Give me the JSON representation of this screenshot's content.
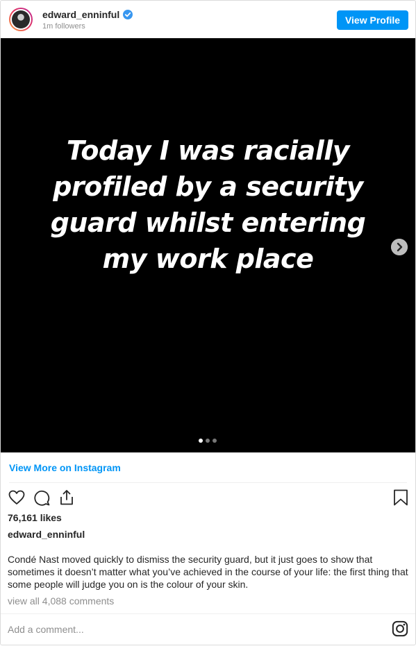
{
  "header": {
    "username": "edward_enninful",
    "followers": "1m followers",
    "view_profile_label": "View Profile"
  },
  "post": {
    "image_text": [
      "Today I was racially",
      "profiled by a security",
      "guard whilst entering",
      "my work place"
    ],
    "carousel": {
      "total": 3,
      "active": 1
    },
    "view_more_label": "View More on Instagram",
    "likes": "76,161 likes",
    "caption_user": "edward_enninful",
    "caption": "Condé Nast moved quickly to dismiss the security guard, but it just goes to show that sometimes it doesn’t matter what you’ve achieved in the course of your life: the first thing that some people will judge you on is the colour of your skin.",
    "comments_link": "view all 4,088 comments",
    "comment_placeholder": "Add a comment..."
  },
  "icons": {
    "verified": "verified-badge-icon",
    "like": "heart-icon",
    "comment": "comment-bubble-icon",
    "share": "share-icon",
    "save": "bookmark-icon",
    "next": "chevron-right-icon",
    "logo": "instagram-logo-icon"
  },
  "colors": {
    "accent": "#0095f6",
    "text": "#262626",
    "muted": "#8e8e8e",
    "border": "#dbdbdb"
  }
}
